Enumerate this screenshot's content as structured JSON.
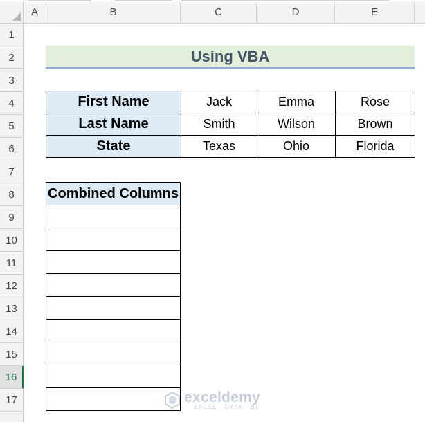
{
  "columns": [
    "A",
    "B",
    "C",
    "D",
    "E"
  ],
  "rows": [
    "1",
    "2",
    "3",
    "4",
    "5",
    "6",
    "7",
    "8",
    "9",
    "10",
    "11",
    "12",
    "13",
    "14",
    "15",
    "16",
    "17"
  ],
  "active_row": "16",
  "title": "Using VBA",
  "table": {
    "rows": [
      {
        "header": "First Name",
        "values": [
          "Jack",
          "Emma",
          "Rose"
        ]
      },
      {
        "header": "Last Name",
        "values": [
          "Smith",
          "Wilson",
          "Brown"
        ]
      },
      {
        "header": "State",
        "values": [
          "Texas",
          "Ohio",
          "Florida"
        ]
      }
    ]
  },
  "combined": {
    "header": "Combined Columns",
    "cells": [
      "",
      "",
      "",
      "",
      "",
      "",
      "",
      "",
      ""
    ]
  },
  "watermark": {
    "name": "exceldemy",
    "tagline": "EXCEL · DATA · BI"
  },
  "colors": {
    "title_bg": "#e2efda",
    "title_text": "#44546a",
    "header_fill": "#ddebf7",
    "active_row": "#1e7145"
  }
}
